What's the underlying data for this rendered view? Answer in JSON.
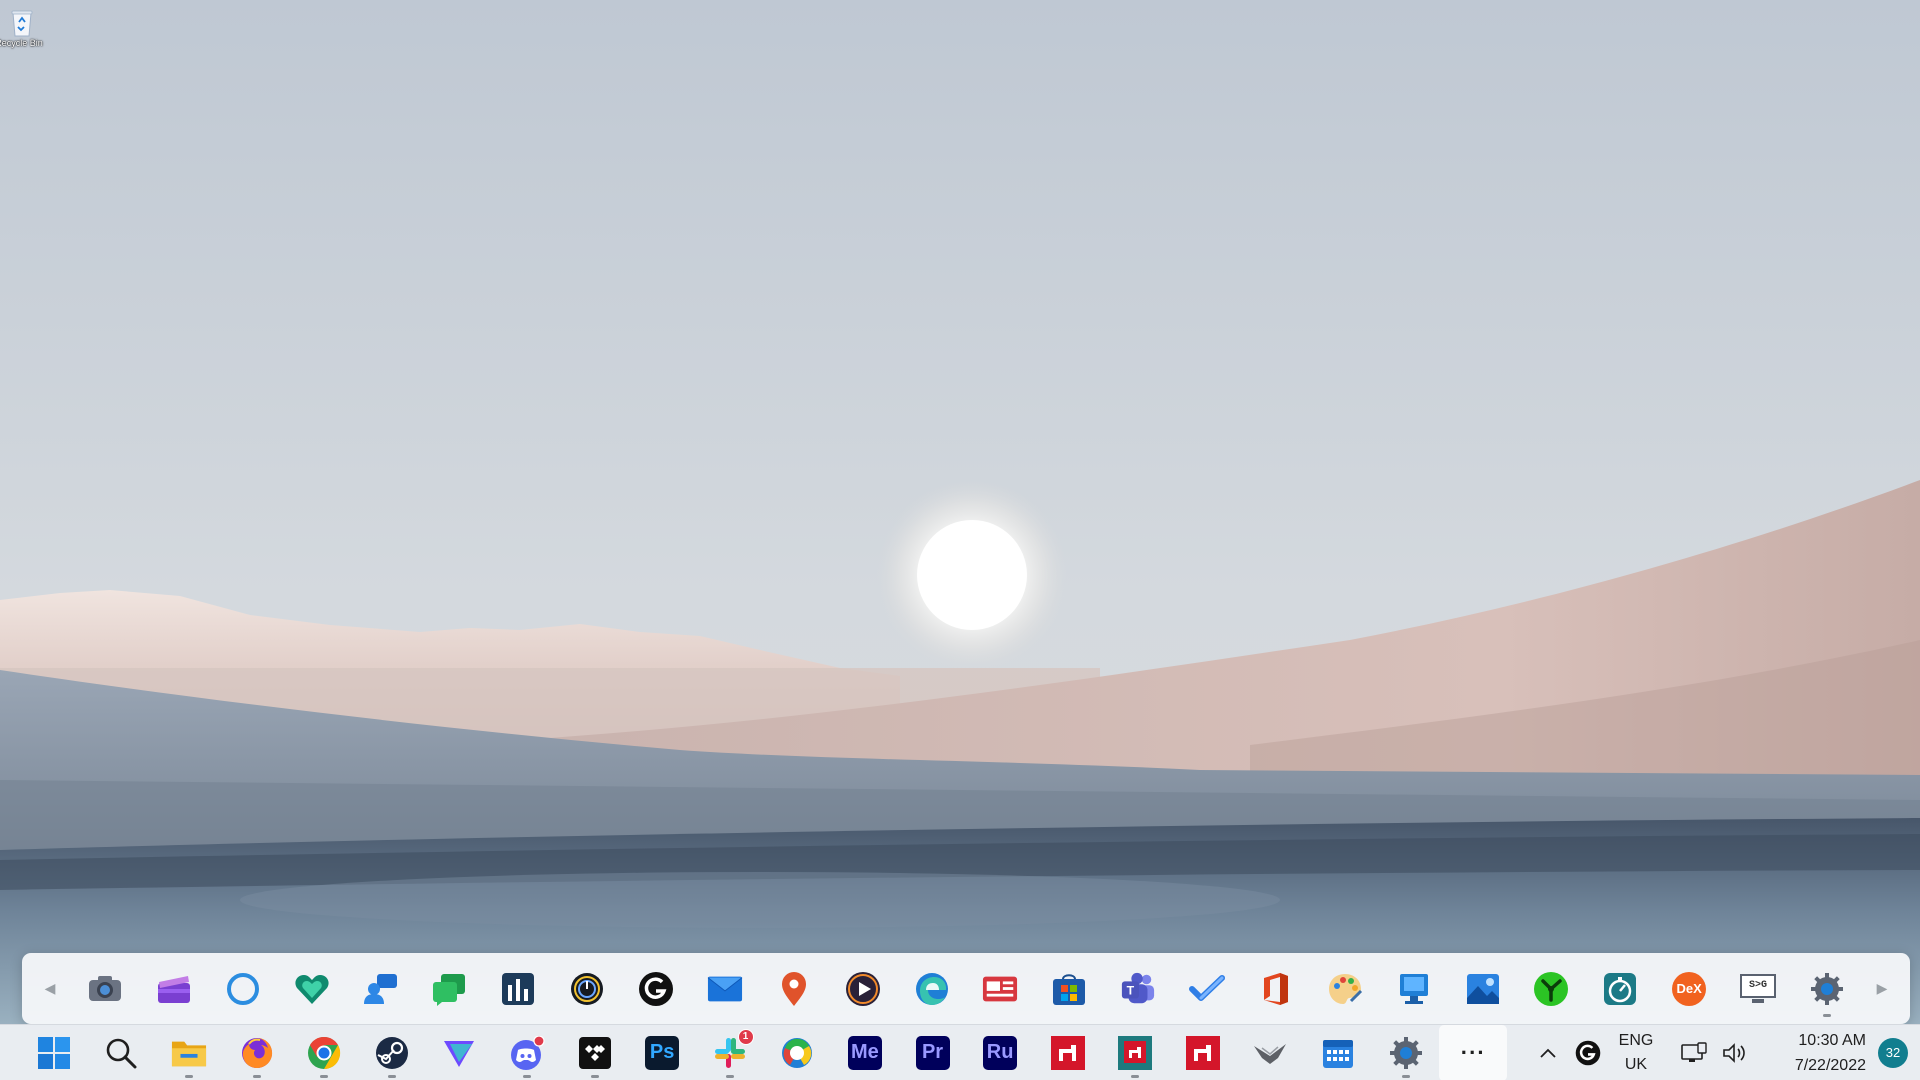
{
  "desktop": {
    "recycle_bin_label": "Recycle Bin"
  },
  "flyout": {
    "left_arrow": "◀",
    "right_arrow": "▶",
    "items": [
      {
        "name": "camera-app-icon"
      },
      {
        "name": "clipchamp-app-icon"
      },
      {
        "name": "cortana-app-icon"
      },
      {
        "name": "health-app-icon"
      },
      {
        "name": "people-app-icon"
      },
      {
        "name": "messages-app-icon"
      },
      {
        "name": "equalizer-app-icon"
      },
      {
        "name": "power-app-icon"
      },
      {
        "name": "logitech-g-hub-icon"
      },
      {
        "name": "mail-app-icon"
      },
      {
        "name": "maps-app-icon"
      },
      {
        "name": "media-player-icon"
      },
      {
        "name": "edge-browser-icon"
      },
      {
        "name": "news-app-icon"
      },
      {
        "name": "microsoft-store-icon"
      },
      {
        "name": "teams-app-icon"
      },
      {
        "name": "todo-app-icon"
      },
      {
        "name": "office-app-icon"
      },
      {
        "name": "paint-app-icon"
      },
      {
        "name": "remote-desktop-icon"
      },
      {
        "name": "photos-app-icon"
      },
      {
        "name": "razer-app-icon"
      },
      {
        "name": "speedtest-app-icon"
      },
      {
        "name": "samsung-dex-icon",
        "text": "DeX"
      },
      {
        "name": "display-switch-icon",
        "text": "S>G"
      },
      {
        "name": "settings-gear-icon"
      }
    ]
  },
  "taskbar": {
    "apps": [
      {
        "name": "start-button"
      },
      {
        "name": "search-button"
      },
      {
        "name": "file-explorer-icon"
      },
      {
        "name": "firefox-icon"
      },
      {
        "name": "chrome-icon"
      },
      {
        "name": "steam-icon"
      },
      {
        "name": "proton-vpn-icon"
      },
      {
        "name": "discord-icon"
      },
      {
        "name": "tidal-icon"
      },
      {
        "name": "photoshop-icon",
        "text": "Ps"
      },
      {
        "name": "slack-icon",
        "badge": "1"
      },
      {
        "name": "photos-edge-icon"
      },
      {
        "name": "media-encoder-icon",
        "text": "Me"
      },
      {
        "name": "premiere-pro-icon",
        "text": "Pr"
      },
      {
        "name": "premiere-rush-icon",
        "text": "Ru"
      },
      {
        "name": "amd-software-icon"
      },
      {
        "name": "amd-link-icon"
      },
      {
        "name": "amd-adrenalin-icon"
      },
      {
        "name": "aorus-icon"
      },
      {
        "name": "calendar-icon"
      },
      {
        "name": "settings-icon"
      },
      {
        "name": "overflow-menu-button",
        "text": "···"
      }
    ],
    "tray": {
      "chevron": "^",
      "lang_line1": "ENG",
      "lang_line2": "UK",
      "time": "10:30 AM",
      "date": "7/22/2022",
      "notification_count": "32"
    }
  }
}
